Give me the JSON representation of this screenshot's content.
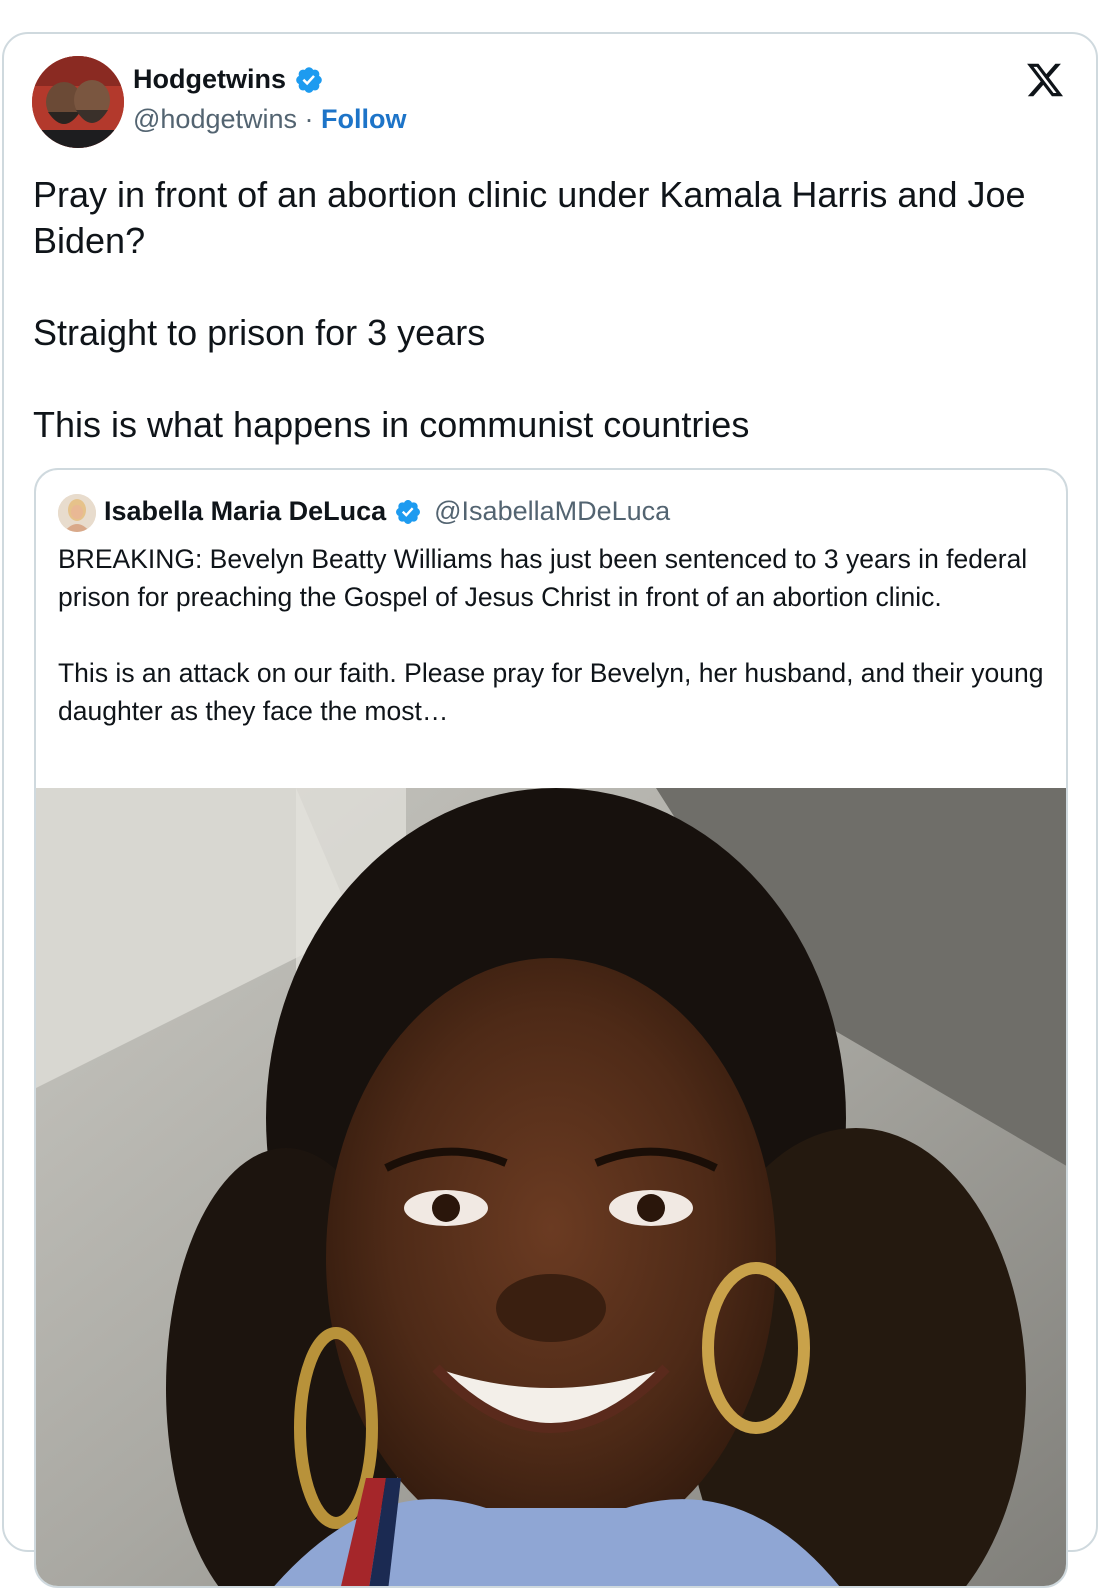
{
  "tweet": {
    "author_name": "Hodgetwins",
    "author_handle": "@hodgetwins",
    "separator": "·",
    "follow_label": "Follow",
    "text_paragraphs": [
      "Pray in front of an abortion clinic under Kamala Harris and Joe Biden?",
      "Straight to prison for 3 years",
      "This is what happens in communist countries"
    ]
  },
  "quote": {
    "author_name": "Isabella Maria DeLuca",
    "author_handle": "@IsabellaMDeLuca",
    "text_paragraphs": [
      "BREAKING: Bevelyn Beatty Williams has just been sentenced to 3 years in federal prison for preaching the Gospel of Jesus Christ in front of an abortion clinic.",
      "This is an attack on our faith. Please pray for Bevelyn, her husband, and their young daughter as they face the most…"
    ]
  },
  "icons": {
    "verified": "verified-badge-icon",
    "platform": "x-logo-icon"
  },
  "colors": {
    "accent": "#1d9bf0",
    "follow": "#1d74c8",
    "muted_text": "#536471",
    "border": "#cfd9de"
  }
}
